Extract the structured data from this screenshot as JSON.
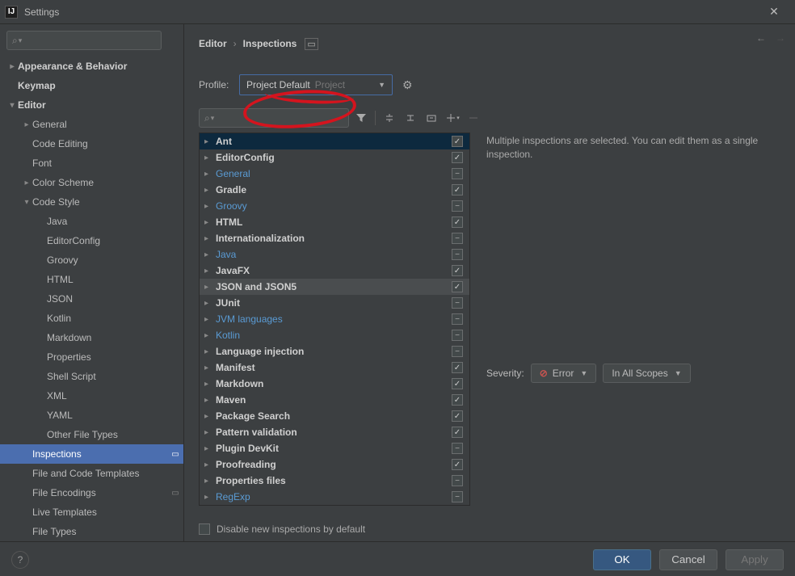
{
  "window": {
    "title": "Settings"
  },
  "search": {
    "placeholder": ""
  },
  "sidebar": {
    "items": [
      {
        "label": "Appearance & Behavior",
        "depth": 0,
        "arrow": "closed",
        "bold": true
      },
      {
        "label": "Keymap",
        "depth": 0,
        "arrow": "none",
        "bold": true
      },
      {
        "label": "Editor",
        "depth": 0,
        "arrow": "open",
        "bold": true
      },
      {
        "label": "General",
        "depth": 1,
        "arrow": "closed"
      },
      {
        "label": "Code Editing",
        "depth": 1,
        "arrow": "none"
      },
      {
        "label": "Font",
        "depth": 1,
        "arrow": "none"
      },
      {
        "label": "Color Scheme",
        "depth": 1,
        "arrow": "closed"
      },
      {
        "label": "Code Style",
        "depth": 1,
        "arrow": "open"
      },
      {
        "label": "Java",
        "depth": 2,
        "arrow": "none"
      },
      {
        "label": "EditorConfig",
        "depth": 2,
        "arrow": "none"
      },
      {
        "label": "Groovy",
        "depth": 2,
        "arrow": "none"
      },
      {
        "label": "HTML",
        "depth": 2,
        "arrow": "none"
      },
      {
        "label": "JSON",
        "depth": 2,
        "arrow": "none"
      },
      {
        "label": "Kotlin",
        "depth": 2,
        "arrow": "none"
      },
      {
        "label": "Markdown",
        "depth": 2,
        "arrow": "none"
      },
      {
        "label": "Properties",
        "depth": 2,
        "arrow": "none"
      },
      {
        "label": "Shell Script",
        "depth": 2,
        "arrow": "none"
      },
      {
        "label": "XML",
        "depth": 2,
        "arrow": "none"
      },
      {
        "label": "YAML",
        "depth": 2,
        "arrow": "none"
      },
      {
        "label": "Other File Types",
        "depth": 2,
        "arrow": "none"
      },
      {
        "label": "Inspections",
        "depth": 1,
        "arrow": "none",
        "selected": true,
        "badge": "▭"
      },
      {
        "label": "File and Code Templates",
        "depth": 1,
        "arrow": "none"
      },
      {
        "label": "File Encodings",
        "depth": 1,
        "arrow": "none",
        "badge": "▭"
      },
      {
        "label": "Live Templates",
        "depth": 1,
        "arrow": "none"
      },
      {
        "label": "File Types",
        "depth": 1,
        "arrow": "none"
      }
    ]
  },
  "breadcrumb": {
    "a": "Editor",
    "b": "Inspections"
  },
  "profile": {
    "label": "Profile:",
    "name": "Project Default",
    "scope": "Project"
  },
  "detail": {
    "text": "Multiple inspections are selected. You can edit them as a single inspection."
  },
  "severity": {
    "label": "Severity:",
    "value": "Error",
    "scope": "In All Scopes"
  },
  "disable": {
    "label": "Disable new inspections by default"
  },
  "inspections": [
    {
      "label": "Ant",
      "state": "checked",
      "bold": true,
      "selected": true
    },
    {
      "label": "EditorConfig",
      "state": "checked",
      "bold": true
    },
    {
      "label": "General",
      "state": "mixed",
      "blue": true
    },
    {
      "label": "Gradle",
      "state": "checked",
      "bold": true
    },
    {
      "label": "Groovy",
      "state": "mixed",
      "blue": true
    },
    {
      "label": "HTML",
      "state": "checked",
      "bold": true
    },
    {
      "label": "Internationalization",
      "state": "mixed",
      "bold": true
    },
    {
      "label": "Java",
      "state": "mixed",
      "blue": true
    },
    {
      "label": "JavaFX",
      "state": "checked",
      "bold": true
    },
    {
      "label": "JSON and JSON5",
      "state": "checked",
      "bold": true,
      "hover": true
    },
    {
      "label": "JUnit",
      "state": "mixed",
      "bold": true
    },
    {
      "label": "JVM languages",
      "state": "mixed",
      "blue": true
    },
    {
      "label": "Kotlin",
      "state": "mixed",
      "blue": true
    },
    {
      "label": "Language injection",
      "state": "mixed",
      "bold": true
    },
    {
      "label": "Manifest",
      "state": "checked",
      "bold": true
    },
    {
      "label": "Markdown",
      "state": "checked",
      "bold": true
    },
    {
      "label": "Maven",
      "state": "checked",
      "bold": true
    },
    {
      "label": "Package Search",
      "state": "checked",
      "bold": true
    },
    {
      "label": "Pattern validation",
      "state": "checked",
      "bold": true
    },
    {
      "label": "Plugin DevKit",
      "state": "mixed",
      "bold": true
    },
    {
      "label": "Proofreading",
      "state": "checked",
      "bold": true
    },
    {
      "label": "Properties files",
      "state": "mixed",
      "bold": true
    },
    {
      "label": "RegExp",
      "state": "mixed",
      "blue": true
    }
  ],
  "buttons": {
    "ok": "OK",
    "cancel": "Cancel",
    "apply": "Apply"
  }
}
